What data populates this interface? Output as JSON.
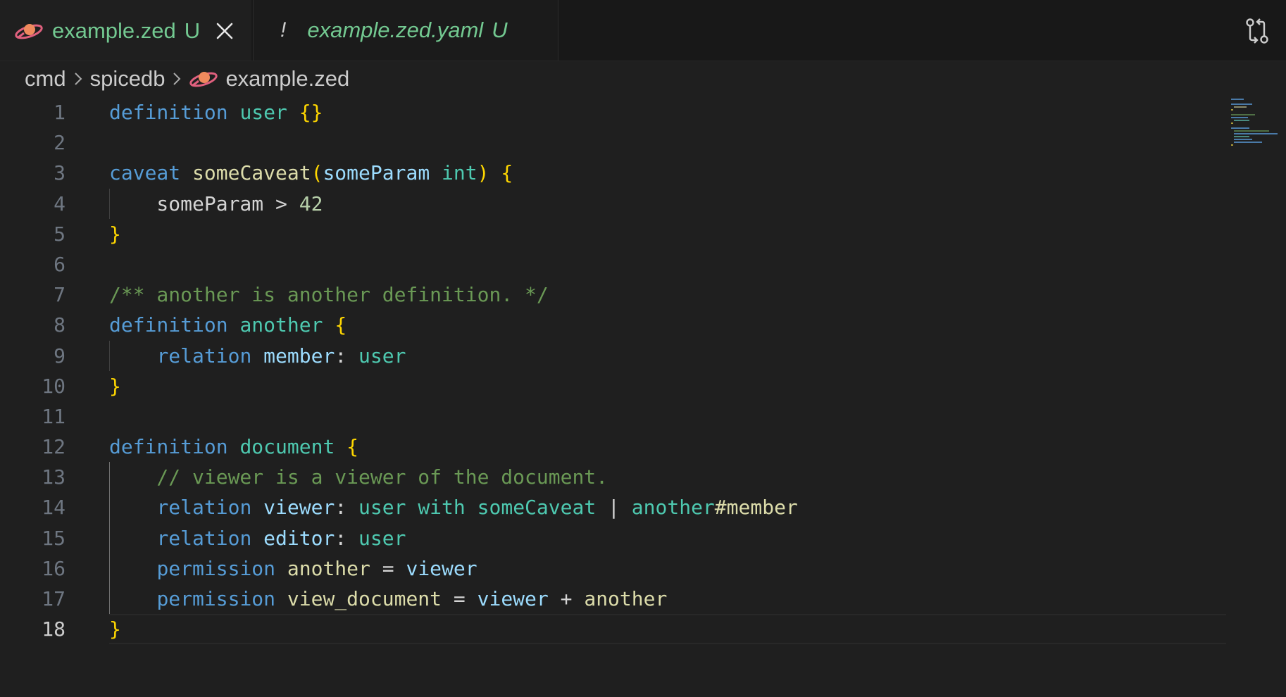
{
  "tabs": [
    {
      "name": "example.zed",
      "status": "U",
      "active": true,
      "icon": "spicedb-logo-icon"
    },
    {
      "name": "example.zed.yaml",
      "status": "U",
      "active": false,
      "icon": "warning-icon",
      "icon_glyph": "!"
    }
  ],
  "breadcrumb": [
    "cmd",
    "spicedb",
    "example.zed"
  ],
  "current_line": 18,
  "colors": {
    "keyword": "#569cd6",
    "type": "#4ec9b0",
    "function": "#dcdcaa",
    "param": "#9cdcfe",
    "brace": "#ffd700",
    "comment": "#6a9955",
    "number": "#b5cea8",
    "git_untracked": "#73c991"
  },
  "code_lines": [
    {
      "n": 1,
      "tokens": [
        [
          "keyword",
          "definition"
        ],
        [
          "text",
          " "
        ],
        [
          "type",
          "user"
        ],
        [
          "text",
          " "
        ],
        [
          "brace",
          "{}"
        ]
      ]
    },
    {
      "n": 2,
      "tokens": []
    },
    {
      "n": 3,
      "tokens": [
        [
          "keyword",
          "caveat"
        ],
        [
          "text",
          " "
        ],
        [
          "func",
          "someCaveat"
        ],
        [
          "brace",
          "("
        ],
        [
          "param",
          "someParam"
        ],
        [
          "text",
          " "
        ],
        [
          "type",
          "int"
        ],
        [
          "brace",
          ")"
        ],
        [
          "text",
          " "
        ],
        [
          "brace",
          "{"
        ]
      ]
    },
    {
      "n": 4,
      "tokens": [
        [
          "text",
          "    someParam > "
        ],
        [
          "number",
          "42"
        ]
      ]
    },
    {
      "n": 5,
      "tokens": [
        [
          "brace",
          "}"
        ]
      ]
    },
    {
      "n": 6,
      "tokens": []
    },
    {
      "n": 7,
      "tokens": [
        [
          "comment",
          "/** another is another definition. */"
        ]
      ]
    },
    {
      "n": 8,
      "tokens": [
        [
          "keyword",
          "definition"
        ],
        [
          "text",
          " "
        ],
        [
          "type",
          "another"
        ],
        [
          "text",
          " "
        ],
        [
          "brace",
          "{"
        ]
      ]
    },
    {
      "n": 9,
      "tokens": [
        [
          "text",
          "    "
        ],
        [
          "keyword",
          "relation"
        ],
        [
          "text",
          " "
        ],
        [
          "param",
          "member"
        ],
        [
          "text",
          ": "
        ],
        [
          "type",
          "user"
        ]
      ]
    },
    {
      "n": 10,
      "tokens": [
        [
          "brace",
          "}"
        ]
      ]
    },
    {
      "n": 11,
      "tokens": []
    },
    {
      "n": 12,
      "tokens": [
        [
          "keyword",
          "definition"
        ],
        [
          "text",
          " "
        ],
        [
          "type",
          "document"
        ],
        [
          "text",
          " "
        ],
        [
          "brace",
          "{"
        ]
      ]
    },
    {
      "n": 13,
      "tokens": [
        [
          "comment",
          "    // viewer is a viewer of the document."
        ]
      ]
    },
    {
      "n": 14,
      "tokens": [
        [
          "text",
          "    "
        ],
        [
          "keyword",
          "relation"
        ],
        [
          "text",
          " "
        ],
        [
          "param",
          "viewer"
        ],
        [
          "text",
          ": "
        ],
        [
          "type",
          "user"
        ],
        [
          "text",
          " "
        ],
        [
          "type",
          "with"
        ],
        [
          "text",
          " "
        ],
        [
          "type",
          "someCaveat"
        ],
        [
          "text",
          " | "
        ],
        [
          "type",
          "another"
        ],
        [
          "func",
          "#member"
        ]
      ]
    },
    {
      "n": 15,
      "tokens": [
        [
          "text",
          "    "
        ],
        [
          "keyword",
          "relation"
        ],
        [
          "text",
          " "
        ],
        [
          "param",
          "editor"
        ],
        [
          "text",
          ": "
        ],
        [
          "type",
          "user"
        ]
      ]
    },
    {
      "n": 16,
      "tokens": [
        [
          "text",
          "    "
        ],
        [
          "keyword",
          "permission"
        ],
        [
          "text",
          " "
        ],
        [
          "func",
          "another"
        ],
        [
          "text",
          " = "
        ],
        [
          "param",
          "viewer"
        ]
      ]
    },
    {
      "n": 17,
      "tokens": [
        [
          "text",
          "    "
        ],
        [
          "keyword",
          "permission"
        ],
        [
          "text",
          " "
        ],
        [
          "func",
          "view_document"
        ],
        [
          "text",
          " = "
        ],
        [
          "param",
          "viewer"
        ],
        [
          "text",
          " + "
        ],
        [
          "func",
          "another"
        ]
      ]
    },
    {
      "n": 18,
      "tokens": [
        [
          "brace",
          "}"
        ]
      ]
    }
  ]
}
